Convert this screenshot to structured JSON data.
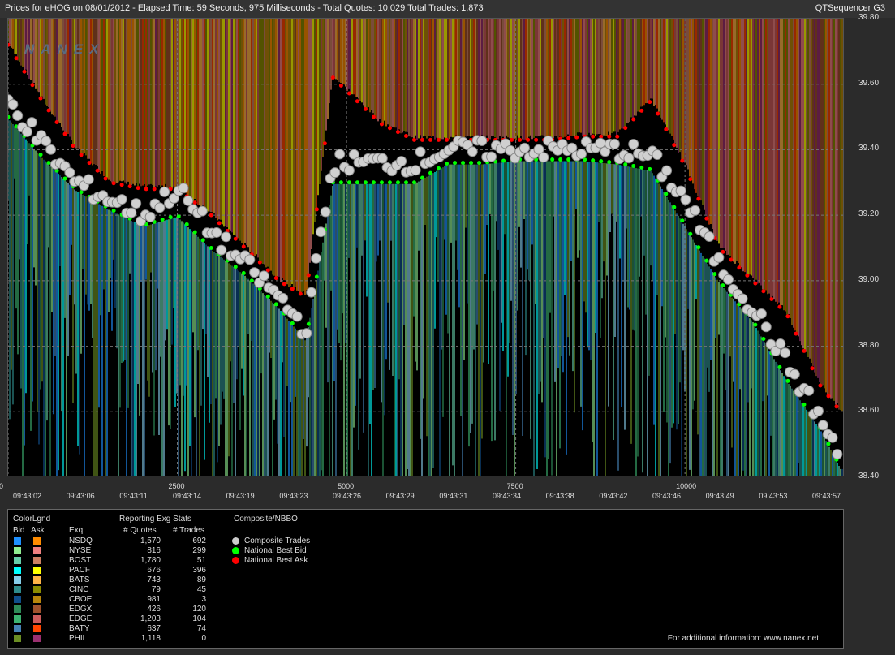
{
  "header": {
    "title": "Prices for  eHOG  on  08/01/2012  -  Elapsed Time: 59 Seconds, 975 Milliseconds  -  Total Quotes: 10,029  Total Trades: 1,873",
    "app": "QTSequencer G3",
    "logo": "NANEX"
  },
  "chart_data": {
    "type": "line",
    "y_ticks": [
      "39.80",
      "39.60",
      "39.40",
      "39.20",
      "39.00",
      "38.80",
      "38.60",
      "38.40"
    ],
    "ylim": [
      38.4,
      39.8
    ],
    "x_seq_ticks": [
      "0",
      "2500",
      "5000",
      "7500",
      "10000"
    ],
    "xlim": [
      0,
      12300
    ],
    "x_time_labels": [
      "09:43:02",
      "09:43:06",
      "09:43:11",
      "09:43:14",
      "09:43:19",
      "09:43:23",
      "09:43:26",
      "09:43:29",
      "09:43:31",
      "09:43:34",
      "09:43:38",
      "09:43:42",
      "09:43:46",
      "09:43:49",
      "09:43:53",
      "09:43:57"
    ],
    "series": [
      {
        "name": "Composite Trades",
        "x": [
          0,
          500,
          1000,
          1500,
          2000,
          2500,
          3000,
          3500,
          4000,
          4400,
          4800,
          5500,
          6000,
          6500,
          7000,
          7500,
          8000,
          8500,
          9000,
          9500,
          10000,
          10500,
          11000,
          11500,
          12000,
          12300
        ],
        "values": [
          39.55,
          39.42,
          39.3,
          39.25,
          39.2,
          39.28,
          39.15,
          39.05,
          38.95,
          38.85,
          39.36,
          39.36,
          39.36,
          39.4,
          39.4,
          39.4,
          39.4,
          39.4,
          39.4,
          39.38,
          39.25,
          39.05,
          38.92,
          38.75,
          38.58,
          38.45
        ]
      },
      {
        "name": "National Best Bid",
        "x": [
          0,
          500,
          1000,
          1500,
          2000,
          2500,
          3000,
          3500,
          4000,
          4400,
          4800,
          5500,
          6000,
          6500,
          7000,
          7500,
          8000,
          8500,
          9000,
          9500,
          10000,
          10500,
          11000,
          11500,
          12000,
          12300
        ],
        "values": [
          39.5,
          39.38,
          39.28,
          39.22,
          39.17,
          39.2,
          39.1,
          39.02,
          38.92,
          38.82,
          39.3,
          39.3,
          39.3,
          39.36,
          39.36,
          39.37,
          39.37,
          39.37,
          39.36,
          39.34,
          39.17,
          39.0,
          38.88,
          38.7,
          38.55,
          38.43
        ]
      },
      {
        "name": "National Best Ask",
        "x": [
          0,
          500,
          1000,
          1500,
          2000,
          2500,
          3000,
          3500,
          4000,
          4400,
          4800,
          5500,
          6000,
          6500,
          7000,
          7500,
          8000,
          8500,
          9000,
          9500,
          10000,
          10500,
          11000,
          11500,
          12000,
          12300
        ],
        "values": [
          39.72,
          39.55,
          39.4,
          39.3,
          39.28,
          39.28,
          39.2,
          39.1,
          39.0,
          38.95,
          39.62,
          39.48,
          39.43,
          39.43,
          39.43,
          39.43,
          39.43,
          39.44,
          39.44,
          39.55,
          39.35,
          39.1,
          39.0,
          38.9,
          38.68,
          38.6
        ]
      }
    ],
    "grid": true
  },
  "legend": {
    "colorlgnd": "ColorLgnd",
    "bid": "Bid",
    "ask": "Ask",
    "exq": "Exq",
    "reporting": "Reporting Exg Stats",
    "quotes_h": "# Quotes",
    "trades_h": "# Trades",
    "composite": "Composite/NBBO",
    "items": [
      {
        "name": "NSDQ",
        "quotes": "1,570",
        "trades": "692",
        "bid": "#1e90ff",
        "ask": "#ff8c00"
      },
      {
        "name": "NYSE",
        "quotes": "816",
        "trades": "299",
        "bid": "#90ee90",
        "ask": "#f08080"
      },
      {
        "name": "BOST",
        "quotes": "1,780",
        "trades": "51",
        "bid": "#66cdaa",
        "ask": "#cd7f62"
      },
      {
        "name": "PACF",
        "quotes": "676",
        "trades": "396",
        "bid": "#00ffff",
        "ask": "#ffff00"
      },
      {
        "name": "BATS",
        "quotes": "743",
        "trades": "89",
        "bid": "#87ceeb",
        "ask": "#ffb347"
      },
      {
        "name": "CINC",
        "quotes": "79",
        "trades": "45",
        "bid": "#2e8b8b",
        "ask": "#8b8b00"
      },
      {
        "name": "CBOE",
        "quotes": "981",
        "trades": "3",
        "bid": "#104e8b",
        "ask": "#b8860b"
      },
      {
        "name": "EDGX",
        "quotes": "426",
        "trades": "120",
        "bid": "#2e8b57",
        "ask": "#a0522d"
      },
      {
        "name": "EDGE",
        "quotes": "1,203",
        "trades": "104",
        "bid": "#3cb371",
        "ask": "#cd5c5c"
      },
      {
        "name": "BATY",
        "quotes": "637",
        "trades": "74",
        "bid": "#4682b4",
        "ask": "#ff4500"
      },
      {
        "name": "PHIL",
        "quotes": "1,118",
        "trades": "0",
        "bid": "#6b8e23",
        "ask": "#9b3070"
      }
    ],
    "nbbo": [
      {
        "label": "Composite Trades",
        "color": "#cccccc"
      },
      {
        "label": "National Best Bid",
        "color": "#00ff00"
      },
      {
        "label": "National Best Ask",
        "color": "#ff0000"
      }
    ],
    "info": "For additional information: www.nanex.net"
  }
}
